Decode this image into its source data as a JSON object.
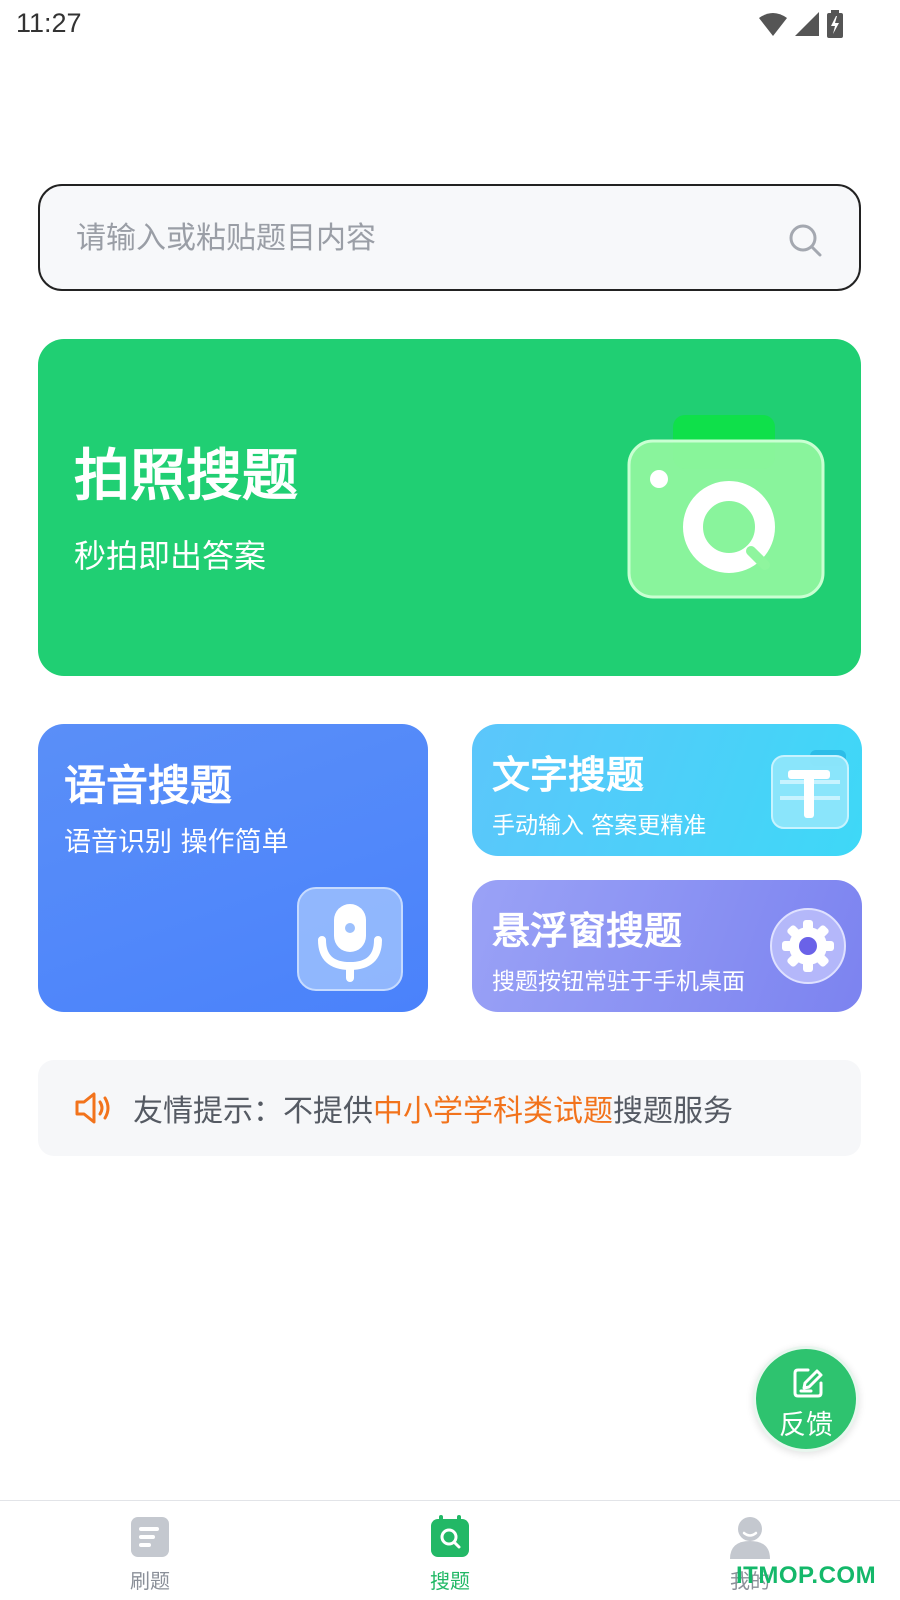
{
  "status_bar": {
    "time": "11:27"
  },
  "search": {
    "placeholder": "请输入或粘贴题目内容"
  },
  "photo_card": {
    "title": "拍照搜题",
    "subtitle": "秒拍即出答案"
  },
  "voice_card": {
    "title": "语音搜题",
    "subtitle": "语音识别 操作简单"
  },
  "text_card": {
    "title": "文字搜题",
    "subtitle": "手动输入 答案更精准"
  },
  "float_card": {
    "title": "悬浮窗搜题",
    "subtitle": "搜题按钮常驻于手机桌面"
  },
  "notice": {
    "prefix": "友情提示：不提供",
    "highlight": "中小学学科类试题",
    "suffix": "搜题服务"
  },
  "feedback": {
    "label": "反馈"
  },
  "nav": {
    "items": [
      {
        "label": "刷题",
        "icon": "document-icon",
        "active": false
      },
      {
        "label": "搜题",
        "icon": "search-calendar-icon",
        "active": true
      },
      {
        "label": "我的",
        "icon": "user-icon",
        "active": false
      }
    ]
  },
  "watermark": "ITMOP.COM",
  "colors": {
    "accent_green": "#20cf73",
    "voice_blue": "#4a82fb",
    "text_cyan": "#3ed8f7",
    "float_purple": "#7c83f0",
    "notice_highlight": "#f2731c",
    "nav_active": "#22b866"
  }
}
